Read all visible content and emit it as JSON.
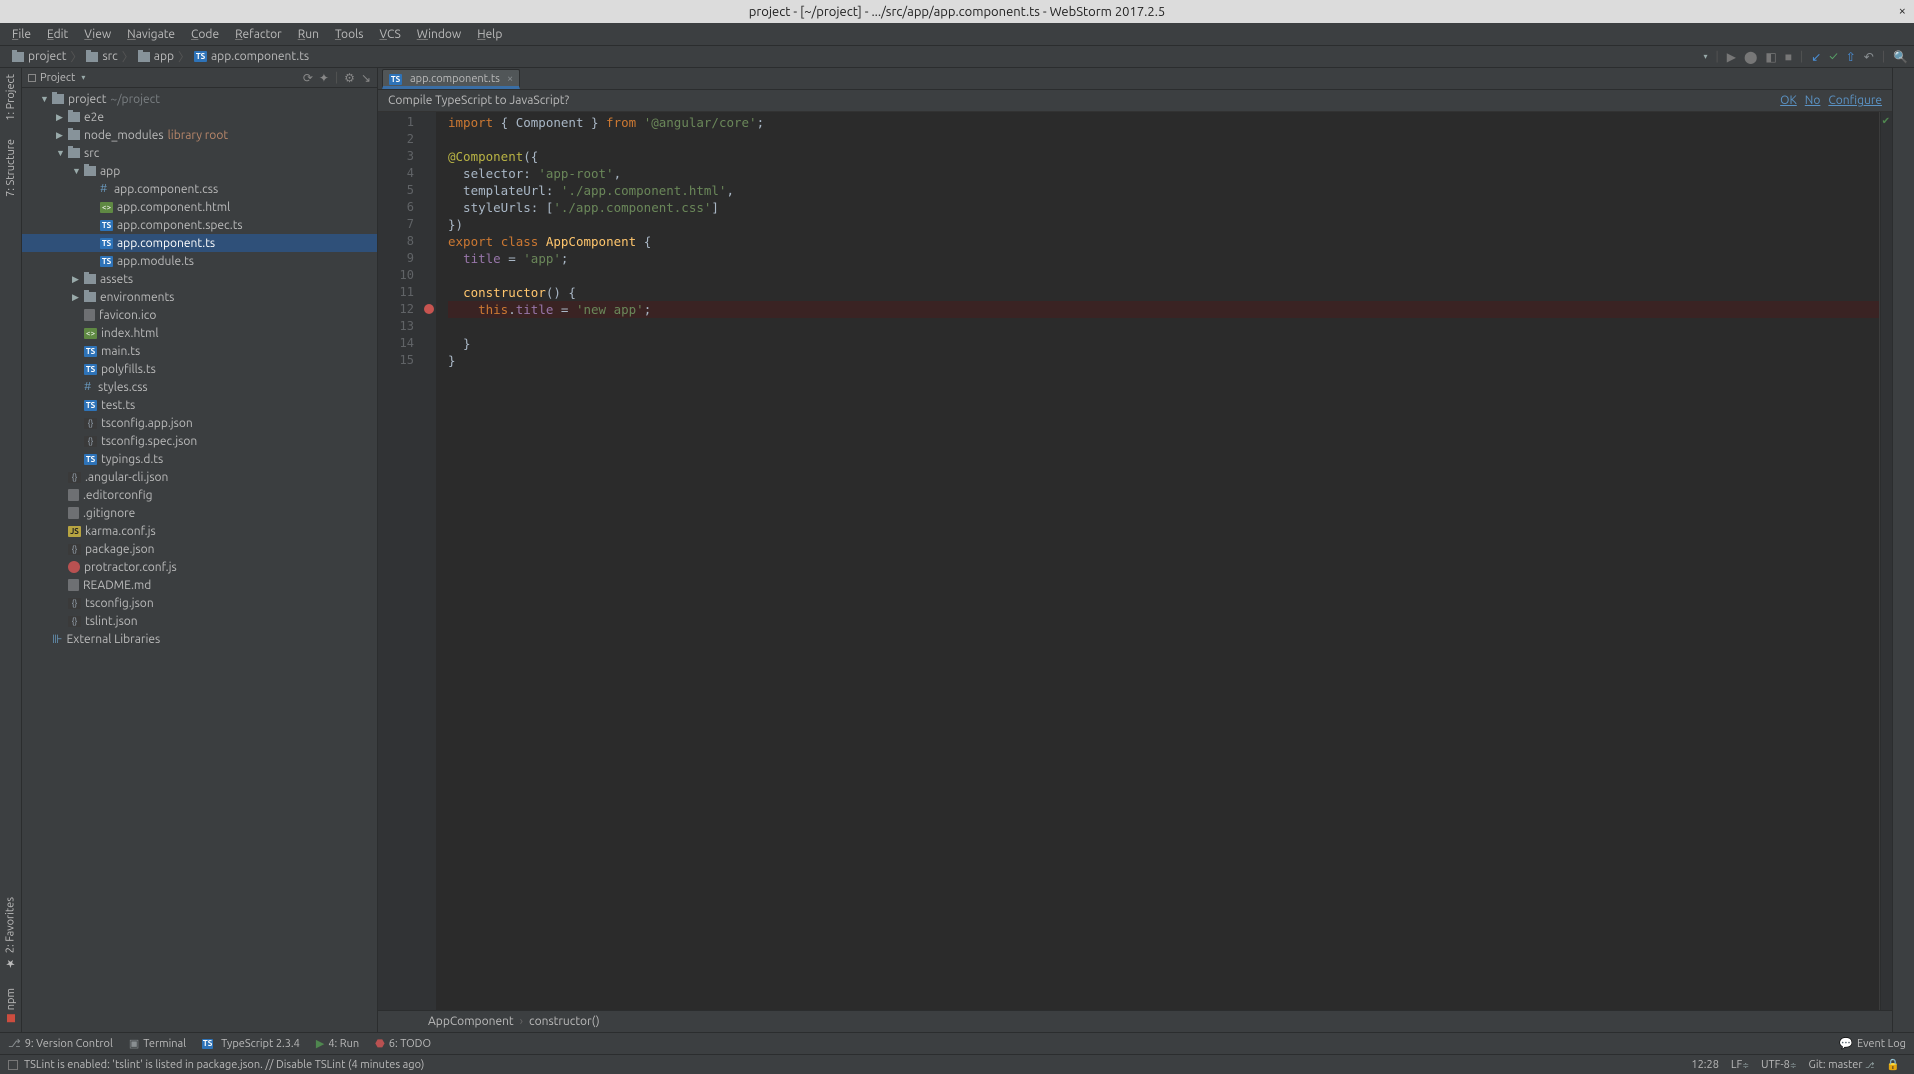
{
  "titlebar": {
    "text": "project - [~/project] - .../src/app/app.component.ts - WebStorm 2017.2.5"
  },
  "menu": [
    "File",
    "Edit",
    "View",
    "Navigate",
    "Code",
    "Refactor",
    "Run",
    "Tools",
    "VCS",
    "Window",
    "Help"
  ],
  "nav_crumbs": [
    {
      "icon": "folder",
      "label": "project"
    },
    {
      "icon": "folder",
      "label": "src"
    },
    {
      "icon": "folder",
      "label": "app"
    },
    {
      "icon": "ts",
      "label": "app.component.ts"
    }
  ],
  "left_tools": [
    "1: Project",
    "7: Structure",
    "2: Favorites",
    "npm"
  ],
  "project_header": {
    "label": "Project"
  },
  "tree": [
    {
      "d": 0,
      "arrow": "▼",
      "icon": "folder",
      "label": "project",
      "suffix": "~/project",
      "suffixClass": "tree-muted"
    },
    {
      "d": 1,
      "arrow": "▶",
      "icon": "folder",
      "label": "e2e"
    },
    {
      "d": 1,
      "arrow": "▶",
      "icon": "folder",
      "label": "node_modules",
      "suffix": "library root",
      "suffixClass": "lib-root"
    },
    {
      "d": 1,
      "arrow": "▼",
      "icon": "folder",
      "label": "src"
    },
    {
      "d": 2,
      "arrow": "▼",
      "icon": "folder",
      "label": "app"
    },
    {
      "d": 3,
      "icon": "hash",
      "label": "app.component.css"
    },
    {
      "d": 3,
      "icon": "html",
      "label": "app.component.html"
    },
    {
      "d": 3,
      "icon": "ts",
      "label": "app.component.spec.ts"
    },
    {
      "d": 3,
      "icon": "ts",
      "label": "app.component.ts",
      "selected": true
    },
    {
      "d": 3,
      "icon": "ts",
      "label": "app.module.ts"
    },
    {
      "d": 2,
      "arrow": "▶",
      "icon": "folder",
      "label": "assets"
    },
    {
      "d": 2,
      "arrow": "▶",
      "icon": "folder",
      "label": "environments"
    },
    {
      "d": 2,
      "icon": "generic",
      "label": "favicon.ico"
    },
    {
      "d": 2,
      "icon": "html",
      "label": "index.html"
    },
    {
      "d": 2,
      "icon": "ts",
      "label": "main.ts"
    },
    {
      "d": 2,
      "icon": "ts",
      "label": "polyfills.ts"
    },
    {
      "d": 2,
      "icon": "hash",
      "label": "styles.css"
    },
    {
      "d": 2,
      "icon": "ts",
      "label": "test.ts"
    },
    {
      "d": 2,
      "icon": "json",
      "label": "tsconfig.app.json"
    },
    {
      "d": 2,
      "icon": "json",
      "label": "tsconfig.spec.json"
    },
    {
      "d": 2,
      "icon": "ts",
      "label": "typings.d.ts"
    },
    {
      "d": 1,
      "icon": "json",
      "label": ".angular-cli.json"
    },
    {
      "d": 1,
      "icon": "generic",
      "label": ".editorconfig"
    },
    {
      "d": 1,
      "icon": "generic",
      "label": ".gitignore"
    },
    {
      "d": 1,
      "icon": "js",
      "label": "karma.conf.js"
    },
    {
      "d": 1,
      "icon": "json",
      "label": "package.json"
    },
    {
      "d": 1,
      "icon": "warn",
      "label": "protractor.conf.js"
    },
    {
      "d": 1,
      "icon": "generic",
      "label": "README.md"
    },
    {
      "d": 1,
      "icon": "json",
      "label": "tsconfig.json"
    },
    {
      "d": 1,
      "icon": "json",
      "label": "tslint.json"
    },
    {
      "d": 0,
      "icon": "lib",
      "label": "External Libraries"
    }
  ],
  "editor": {
    "tab_label": "app.component.ts",
    "notif": "Compile TypeScript to JavaScript?",
    "notif_ok": "OK",
    "notif_no": "No",
    "notif_cfg": "Configure",
    "lines": [
      1,
      2,
      3,
      4,
      5,
      6,
      7,
      8,
      9,
      10,
      11,
      12,
      13,
      14,
      15
    ],
    "breakpoint_line": 12,
    "code_html": "<span class='kw'>import</span> { Component } <span class='kw'>from</span> <span class='str'>'@angular/core'</span>;\n\n<span class='at'>@Component</span>({\n  selector: <span class='str'>'app-root'</span>,\n  templateUrl: <span class='str'>'./app.component.html'</span>,\n  styleUrls: [<span class='str'>'./app.component.css'</span>]\n})\n<span class='kw'>export</span> <span class='kw'>class</span> <span class='id'>AppComponent</span> {\n  <span class='field'>title</span> = <span class='str'>'app'</span>;\n\n  <span class='id'>constructor</span>() {\n<span class='bp-line'>    <span class='kw'>this</span>.<span class='field'>title</span> = <span class='str'>'new app'</span>;</span>\n  }\n}\n",
    "crumb1": "AppComponent",
    "crumb2": "constructor()"
  },
  "bottom": {
    "items": [
      {
        "icon": "branch",
        "label": "9: Version Control"
      },
      {
        "icon": "term",
        "label": "Terminal"
      },
      {
        "icon": "ts",
        "label": "TypeScript 2.3.4"
      },
      {
        "icon": "play",
        "label": "4: Run"
      },
      {
        "icon": "bug",
        "label": "6: TODO"
      }
    ],
    "event_log": "Event Log"
  },
  "status": {
    "msg": "TSLint is enabled: 'tslint' is listed in package.json. // Disable TSLint (4 minutes ago)",
    "cursor": "12:28",
    "le": "LF",
    "enc": "UTF-8",
    "git": "Git: master"
  }
}
